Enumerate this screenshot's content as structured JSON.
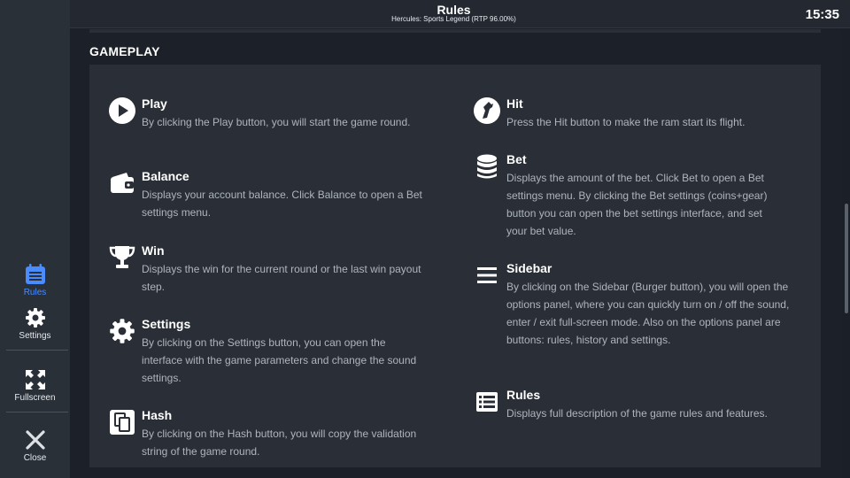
{
  "header": {
    "title": "Rules",
    "subtitle": "Hercules: Sports Legend (RTP 96.00%)",
    "clock": "15:35"
  },
  "sidebar": {
    "accent": "#4a8cff",
    "rules_label": "Rules",
    "settings_label": "Settings",
    "fullscreen_label": "Fullscreen",
    "close_label": "Close"
  },
  "section": {
    "title": "GAMEPLAY"
  },
  "items": {
    "play": {
      "icon": "play-icon",
      "name": "Play",
      "desc": "By clicking the Play button, you will start the game round."
    },
    "balance": {
      "icon": "wallet-icon",
      "name": "Balance",
      "desc": "Displays your account balance. Click Balance to open a Bet settings menu."
    },
    "win": {
      "icon": "trophy-icon",
      "name": "Win",
      "desc": "Displays the win for the current round or the last win payout step."
    },
    "settings": {
      "icon": "gear-icon",
      "name": "Settings",
      "desc": "By clicking on the Settings button, you can open the interface with the game parameters and change the sound settings."
    },
    "hash": {
      "icon": "copy-icon",
      "name": "Hash",
      "desc": "By clicking on the Hash button, you will copy the validation string of the game round."
    },
    "hit": {
      "icon": "hit-icon",
      "name": "Hit",
      "desc": "Press the Hit button to make the ram start its flight."
    },
    "bet": {
      "icon": "coins-icon",
      "name": "Bet",
      "desc": "Displays the amount of the bet. Click Bet to open a Bet settings menu. By clicking the Bet settings (coins+gear) button you can open the bet settings interface, and set your bet value."
    },
    "sidebar": {
      "icon": "burger-icon",
      "name": "Sidebar",
      "desc": "By clicking on the Sidebar (Burger button), you will open the options panel, where you can quickly turn on / off the sound, enter / exit full-screen mode. Also on the options panel are buttons: rules, history and settings."
    },
    "rules": {
      "icon": "list-icon",
      "name": "Rules",
      "desc": "Displays full description of the game rules and features."
    }
  }
}
